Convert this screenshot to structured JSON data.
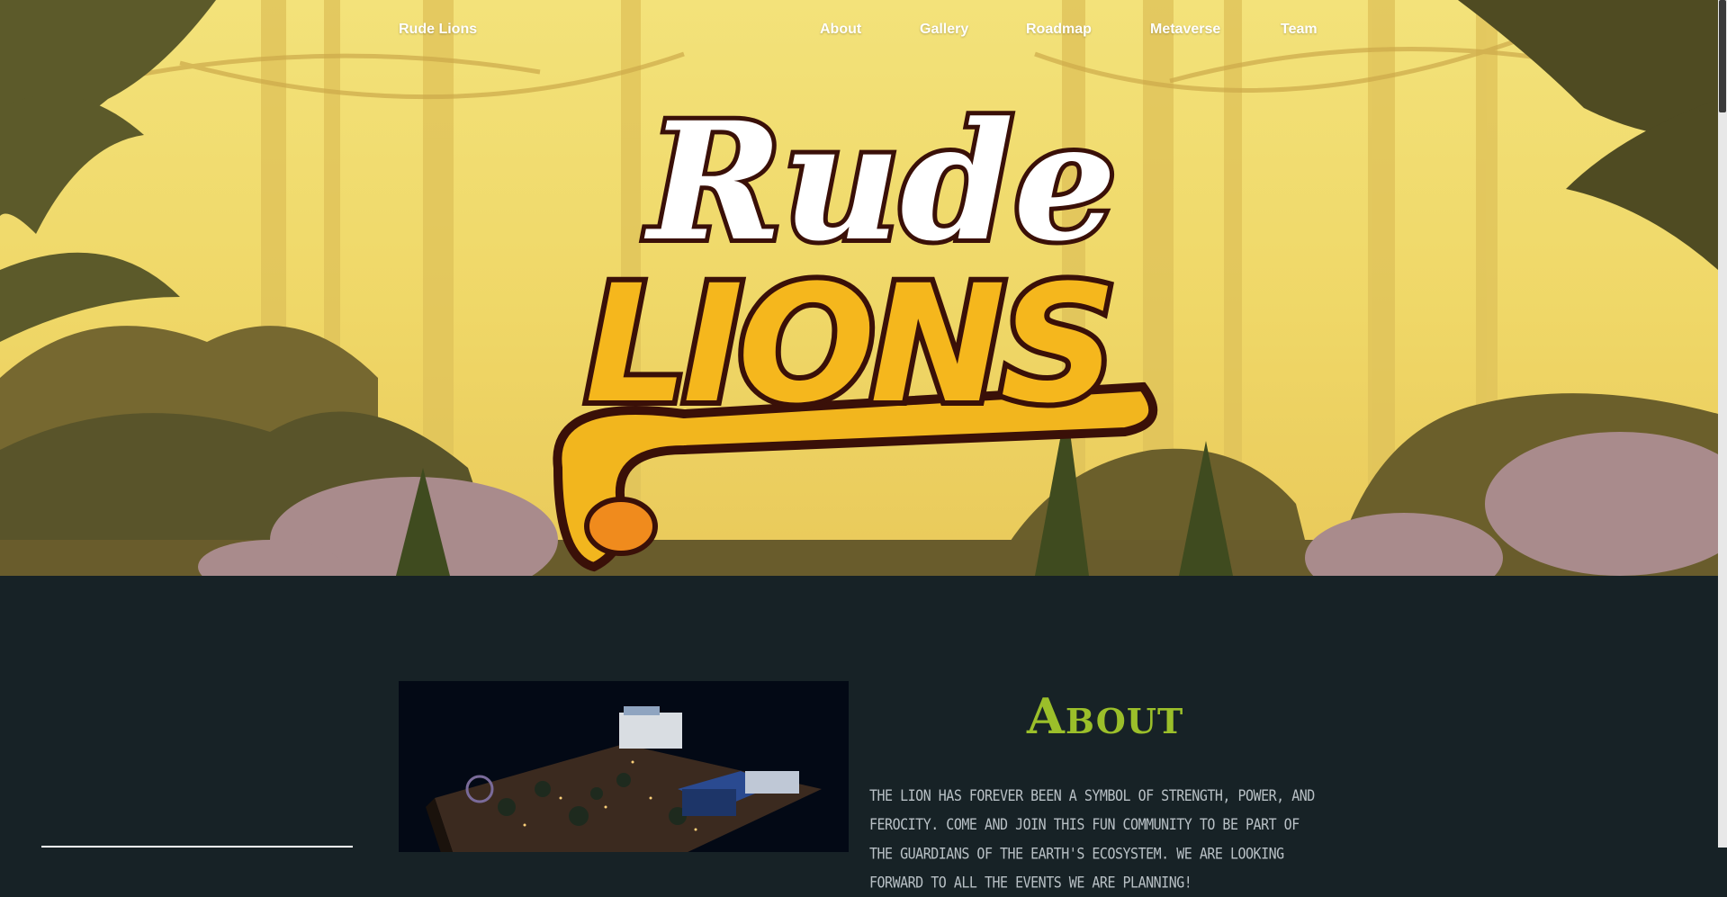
{
  "nav": {
    "brand": "Rude Lions",
    "links": [
      "About",
      "Gallery",
      "Roadmap",
      "Metaverse",
      "Team"
    ]
  },
  "hero": {
    "logo_line1": "Rude",
    "logo_line2": "LIONS"
  },
  "about": {
    "title": "About",
    "text": "The lion has forever been a symbol of strength, power, and ferocity. Come and join this fun community to be part of the guardians of the Earth's ecosystem. We are looking forward to all the events we are planning!"
  },
  "colors": {
    "accent": "#9bbf2a",
    "section_bg": "#172226",
    "hero_bg": "#f3e27a"
  }
}
